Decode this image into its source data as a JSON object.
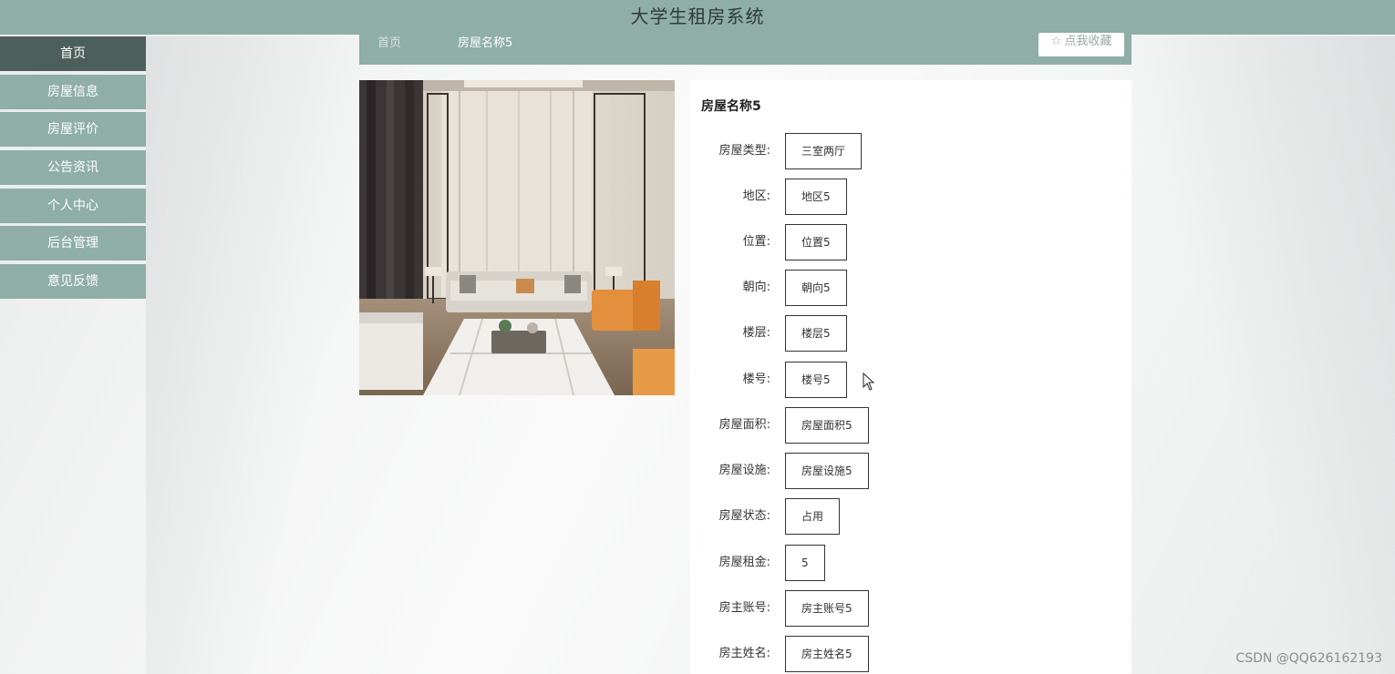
{
  "header": {
    "title": "大学生租房系统"
  },
  "sidebar": {
    "items": [
      {
        "label": "首页",
        "active": true
      },
      {
        "label": "房屋信息"
      },
      {
        "label": "房屋评价"
      },
      {
        "label": "公告资讯"
      },
      {
        "label": "个人中心"
      },
      {
        "label": "后台管理"
      },
      {
        "label": "意见反馈"
      }
    ]
  },
  "breadcrumb": {
    "home": "首页",
    "current": "房屋名称5"
  },
  "favorite_button": {
    "icon": "star-outline-icon",
    "label": "点我收藏"
  },
  "detail": {
    "title": "房屋名称5",
    "fields": [
      {
        "label": "房屋类型:",
        "value": "三室两厅"
      },
      {
        "label": "地区:",
        "value": "地区5"
      },
      {
        "label": "位置:",
        "value": "位置5"
      },
      {
        "label": "朝向:",
        "value": "朝向5"
      },
      {
        "label": "楼层:",
        "value": "楼层5"
      },
      {
        "label": "楼号:",
        "value": "楼号5"
      },
      {
        "label": "房屋面积:",
        "value": "房屋面积5"
      },
      {
        "label": "房屋设施:",
        "value": "房屋设施5"
      },
      {
        "label": "房屋状态:",
        "value": "占用"
      },
      {
        "label": "房屋租金:",
        "value": "5"
      },
      {
        "label": "房主账号:",
        "value": "房主账号5"
      },
      {
        "label": "房主姓名:",
        "value": "房主姓名5"
      }
    ]
  },
  "watermark": "CSDN @QQ626162193",
  "colors": {
    "primary": "#8eaea7",
    "active_nav": "#4c5f5a"
  }
}
